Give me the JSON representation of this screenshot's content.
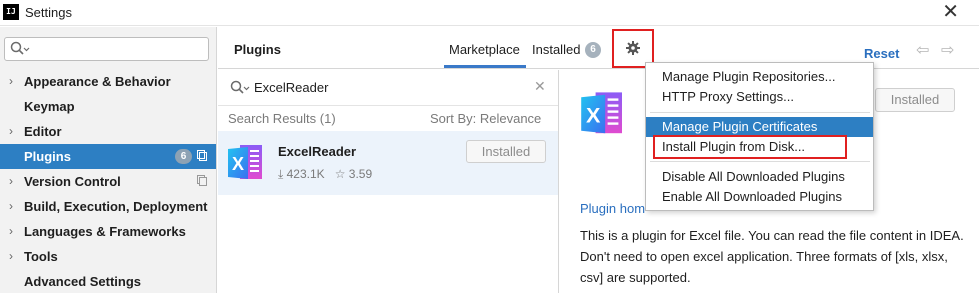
{
  "window": {
    "app_icon": "IJ",
    "title": "Settings",
    "close": "✕"
  },
  "sidebar": {
    "search_placeholder": "",
    "items": [
      {
        "label": "Appearance & Behavior",
        "chevron": "›"
      },
      {
        "label": "Keymap",
        "chevron": ""
      },
      {
        "label": "Editor",
        "chevron": "›"
      },
      {
        "label": "Plugins",
        "chevron": "",
        "badge": "6",
        "selected": true
      },
      {
        "label": "Version Control",
        "chevron": "›"
      },
      {
        "label": "Build, Execution, Deployment",
        "chevron": "›"
      },
      {
        "label": "Languages & Frameworks",
        "chevron": "›"
      },
      {
        "label": "Tools",
        "chevron": "›"
      },
      {
        "label": "Advanced Settings",
        "chevron": ""
      }
    ]
  },
  "header": {
    "title": "Plugins",
    "tabs": [
      {
        "label": "Marketplace",
        "active": true
      },
      {
        "label": "Installed",
        "badge": "6"
      }
    ],
    "reset": "Reset",
    "back": "⇦",
    "forward": "⇨"
  },
  "list": {
    "search_value": "ExcelReader",
    "clear": "✕",
    "results_label": "Search Results (1)",
    "sort_label": "Sort By: Relevance ▾",
    "plugin": {
      "name": "ExcelReader",
      "downloads": "⤓ 423.1K",
      "rating": "☆ 3.59",
      "button": "Installed"
    }
  },
  "detail": {
    "button": "Installed",
    "link": "Plugin hom",
    "description": "This is a plugin for Excel file. You can read the file content in IDEA. Don't need to open excel application. Three formats of [xls, xlsx, csv] are supported."
  },
  "menu": {
    "items": [
      "Manage Plugin Repositories...",
      "HTTP Proxy Settings...",
      "Manage Plugin Certificates",
      "Install Plugin from Disk...",
      "Disable All Downloaded Plugins",
      "Enable All Downloaded Plugins"
    ]
  },
  "colors": {
    "selection": "#2d7fc3",
    "highlight_box": "#e02020",
    "link": "#2a6fbf"
  }
}
